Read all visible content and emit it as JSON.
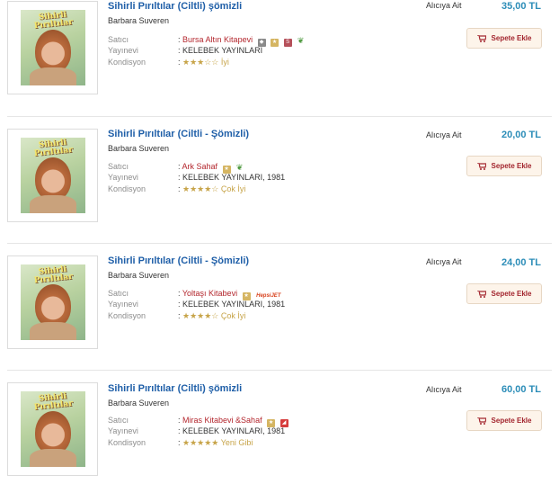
{
  "labels": {
    "seller": "Satıcı",
    "publisher": "Yayınevi",
    "condition": "Kondisyon",
    "colon": ":"
  },
  "colors": {
    "title": "#1f5fa8",
    "price": "#2c8db8",
    "shop": "#b3262d",
    "button_bg": "#fdf4ea",
    "condition": "#c7a449"
  },
  "listings": [
    {
      "title": "Sihirli Pırıltılar (Ciltli) şömizli",
      "author": "Barbara Suveren",
      "seller": "Bursa Altın Kitapevi",
      "publisher": "KELEBEK YAYINLARI",
      "stars": "★★★☆☆",
      "condition": "İyi",
      "shipping": "Alıcıya Ait",
      "price": "35,00 TL",
      "button": "Sepete Ekle",
      "cover_text": "Sihirli Pırıltılar"
    },
    {
      "title": "Sihirli Pırıltılar (Ciltli - Şömizli)",
      "author": "Barbara Suveren",
      "seller": "Ark Sahaf",
      "publisher": "KELEBEK YAYINLARI, 1981",
      "stars": "★★★★☆",
      "condition": "Çok İyi",
      "shipping": "Alıcıya Ait",
      "price": "20,00 TL",
      "button": "Sepete Ekle",
      "cover_text": "Sihirli Pırıltılar"
    },
    {
      "title": "Sihirli Pırıltılar (Ciltli - Şömizli)",
      "author": "Barbara Suveren",
      "seller": "Yoltaşı Kitabevi",
      "publisher": "KELEBEK YAYINLARI, 1981",
      "stars": "★★★★☆",
      "condition": "Çok İyi",
      "shipping": "Alıcıya Ait",
      "price": "24,00 TL",
      "button": "Sepete Ekle",
      "cover_text": "Sihirli Pırıltılar",
      "jet_badge": "HepsiJET"
    },
    {
      "title": "Sihirli Pırıltılar (Ciltli) şömizli",
      "author": "Barbara Suveren",
      "seller": "Miras Kitabevi &Sahaf",
      "publisher": "KELEBEK YAYINLARI, 1981",
      "stars": "★★★★★",
      "condition": "Yeni Gibi",
      "shipping": "Alıcıya Ait",
      "price": "60,00 TL",
      "button": "Sepete Ekle",
      "cover_text": "Sihirli Pırıltılar"
    }
  ]
}
